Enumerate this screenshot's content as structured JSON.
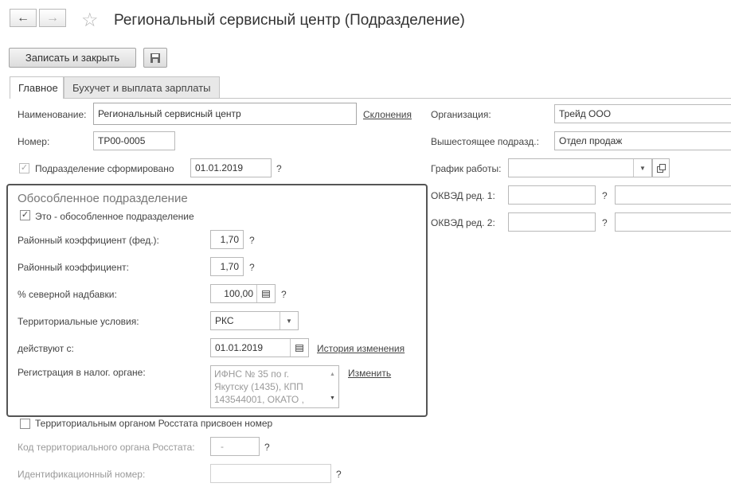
{
  "window": {
    "title": "Региональный сервисный центр (Подразделение)",
    "back_icon": "←",
    "forward_icon": "→",
    "star_icon": "☆"
  },
  "toolbar": {
    "save_close_label": "Записать и закрыть",
    "save_icon": "floppy-disk-icon"
  },
  "tabs": [
    {
      "label": "Главное",
      "active": true
    },
    {
      "label": "Бухучет и выплата зарплаты",
      "active": false
    }
  ],
  "main": {
    "name_label": "Наименование:",
    "name_value": "Региональный сервисный центр",
    "declensions_link": "Склонения",
    "number_label": "Номер:",
    "number_value": "ТР00-0005",
    "formed_label": "Подразделение сформировано",
    "formed_checked": true,
    "formed_date": "01.01.2019",
    "help_mark": "?"
  },
  "right": {
    "organization_label": "Организация:",
    "organization_value": "Трейд ООО",
    "parent_label": "Вышестоящее подразд.:",
    "parent_value": "Отдел продаж",
    "schedule_label": "График работы:",
    "schedule_value": "",
    "okved1_label": "ОКВЭД ред. 1:",
    "okved2_label": "ОКВЭД ред. 2:"
  },
  "separate": {
    "group_title": "Обособленное подразделение",
    "is_separate_label": "Это - обособленное подразделение",
    "is_separate_checked": true,
    "fed_coef_label": "Районный коэффициент (фед.):",
    "fed_coef_value": "1,70",
    "coef_label": "Районный коэффициент:",
    "coef_value": "1,70",
    "north_label": "% северной надбавки:",
    "north_value": "100,00",
    "terr_cond_label": "Территориальные условия:",
    "terr_cond_value": "РКС",
    "valid_from_label": "действуют с:",
    "valid_from_value": "01.01.2019",
    "history_link": "История изменения",
    "tax_reg_label": "Регистрация в налог. органе:",
    "tax_reg_value": "ИФНС № 35 по г. Якутску (1435), КПП 143544001, ОКАТО ,",
    "change_link": "Изменить"
  },
  "rosstat": {
    "assigned_label": "Территориальным органом Росстата присвоен номер",
    "assigned_checked": false,
    "code_label": "Код территориального органа Росстата:",
    "code_value": "-",
    "id_label": "Идентификационный номер:",
    "id_value": ""
  }
}
